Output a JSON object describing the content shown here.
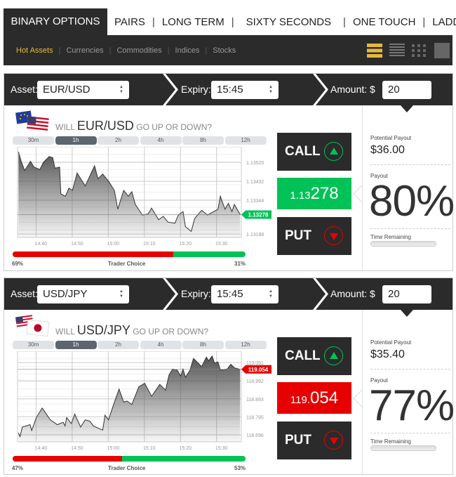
{
  "nav": {
    "brand": "BINARY OPTIONS",
    "tabs": [
      "PAIRS",
      "LONG TERM",
      "SIXTY SECONDS",
      "ONE TOUCH",
      "LADDER"
    ],
    "categories": [
      "Hot Assets",
      "Currencies",
      "Commodities",
      "Indices",
      "Stocks"
    ],
    "active_category": "Hot Assets",
    "view_icons": [
      "large-list-icon",
      "compact-list-icon",
      "grid-icon",
      "single-view-icon"
    ],
    "active_view": "large-list-icon"
  },
  "colors": {
    "accent": "#e6b93a",
    "up": "#00c257",
    "down": "#e60000",
    "dark": "#2b2b2b"
  },
  "panels": [
    {
      "asset_label": "Asset:",
      "asset": "EUR/USD",
      "expiry_label": "Expiry:",
      "expiry": "15:45",
      "amount_label": "Amount: $",
      "amount": "20",
      "question_pre": "WILL",
      "question_asset": "EUR/USD",
      "question_post": "GO UP OR DOWN?",
      "flag": "eu-us-flag-icon",
      "timeframes": [
        "30m",
        "1h",
        "2h",
        "4h",
        "8h",
        "12h"
      ],
      "active_timeframe": "1h",
      "call_label": "CALL",
      "put_label": "PUT",
      "price_prefix": "1.13",
      "price_main": "278",
      "price_direction": "up",
      "trader_choice_label": "Trader Choice",
      "put_pct": "69%",
      "call_pct": "31%",
      "put_share": 69,
      "potential_payout_label": "Potential Payout",
      "potential_payout": "$36.00",
      "payout_label": "Payout",
      "payout": "80%",
      "time_remaining_label": "Time Remaining"
    },
    {
      "asset_label": "Asset:",
      "asset": "USD/JPY",
      "expiry_label": "Expiry:",
      "expiry": "15:45",
      "amount_label": "Amount: $",
      "amount": "20",
      "question_pre": "WILL",
      "question_asset": "USD/JPY",
      "question_post": "GO UP OR DOWN?",
      "flag": "us-jp-flag-icon",
      "timeframes": [
        "30m",
        "1h",
        "2h",
        "4h",
        "8h",
        "12h"
      ],
      "active_timeframe": "1h",
      "call_label": "CALL",
      "put_label": "PUT",
      "price_prefix": "119.",
      "price_main": "054",
      "price_direction": "down",
      "trader_choice_label": "Trader Choice",
      "put_pct": "47%",
      "call_pct": "53%",
      "put_share": 47,
      "potential_payout_label": "Potential Payout",
      "potential_payout": "$35.40",
      "payout_label": "Payout",
      "payout": "77%",
      "time_remaining_label": "Time Remaining"
    }
  ],
  "chart_data": [
    {
      "type": "area",
      "xlabel": "",
      "ylabel": "",
      "x_ticks": [
        "14:40",
        "14:50",
        "15:00",
        "15:10",
        "15:20",
        "15:30"
      ],
      "y_ticks": [
        "1.13520",
        "1.13432",
        "1.13344",
        "1.13188"
      ],
      "xlim": [
        "14:33:30",
        "15:35:30"
      ],
      "ylim": [
        1.13172,
        1.13592
      ],
      "grid": true,
      "current_value": "1.13278",
      "x": [
        "14:33:45",
        "14:34:31",
        "14:35:29",
        "14:37:06",
        "14:38:04",
        "14:39:41",
        "14:40:39",
        "14:42:16",
        "14:43:14",
        "14:43:52",
        "14:45:10",
        "14:45:29",
        "14:46:46",
        "14:47:44",
        "14:48:43",
        "14:50:00",
        "14:52:15",
        "14:54:50",
        "14:55:48",
        "14:57:06",
        "14:58:43",
        "15:00:19",
        "15:01:17",
        "15:02:54",
        "15:04:12",
        "15:05:10",
        "15:06:08",
        "15:08:04",
        "15:09:41",
        "15:10:39",
        "15:12:35",
        "15:13:52",
        "15:15:10",
        "15:17:06",
        "15:18:04",
        "15:19:21",
        "15:20:00",
        "15:21:37",
        "15:22:35",
        "15:24:31",
        "15:26:08",
        "15:29:02",
        "15:29:41",
        "15:30:58",
        "15:31:56",
        "15:32:54",
        "15:33:33",
        "15:35:10"
      ],
      "values": [
        1.13569,
        1.13525,
        1.13482,
        1.13525,
        1.13498,
        1.13487,
        1.1352,
        1.13547,
        1.13542,
        1.13493,
        1.13498,
        1.13374,
        1.13363,
        1.13401,
        1.1339,
        1.13471,
        1.13411,
        1.13504,
        1.13444,
        1.13466,
        1.13433,
        1.1339,
        1.13303,
        1.1339,
        1.13363,
        1.13384,
        1.13325,
        1.13276,
        1.13281,
        1.13308,
        1.13254,
        1.1327,
        1.13243,
        1.13238,
        1.13276,
        1.13292,
        1.13222,
        1.132,
        1.1326,
        1.13298,
        1.13276,
        1.13303,
        1.13363,
        1.13303,
        1.1333,
        1.13292,
        1.13325,
        1.13278
      ]
    },
    {
      "type": "area",
      "xlabel": "",
      "ylabel": "",
      "x_ticks": [
        "14:40",
        "14:50",
        "15:00",
        "15:10",
        "15:20",
        "15:30"
      ],
      "y_ticks": [
        "119.091",
        "118.992",
        "118.893",
        "118.795",
        "118.696"
      ],
      "xlim": [
        "14:33:30",
        "15:35:30"
      ],
      "ylim": [
        118.658,
        119.153
      ],
      "grid": true,
      "current_value": "119.054",
      "x": [
        "14:33:45",
        "14:34:11",
        "14:34:50",
        "14:36:58",
        "14:37:25",
        "14:38:43",
        "14:40:19",
        "14:42:35",
        "14:44:31",
        "14:46:08",
        "14:46:39",
        "14:47:06",
        "14:48:23",
        "14:49:21",
        "14:50:58",
        "14:52:15",
        "14:53:33",
        "14:54:31",
        "14:57:06",
        "14:57:44",
        "14:58:43",
        "15:00:00",
        "15:01:37",
        "15:02:54",
        "15:03:52",
        "15:05:10",
        "15:07:06",
        "15:08:43",
        "15:10:39",
        "15:12:54",
        "15:14:31",
        "15:15:29",
        "15:16:27",
        "15:17:44",
        "15:18:43",
        "15:19:21",
        "15:20:00",
        "15:21:17",
        "15:22:15",
        "15:24:31",
        "15:25:49",
        "15:26:27",
        "15:27:25",
        "15:28:04",
        "15:29:02",
        "15:29:41",
        "15:31:37",
        "15:32:35",
        "15:33:33",
        "15:35:10"
      ],
      "values": [
        118.707,
        118.687,
        118.739,
        118.752,
        118.72,
        118.791,
        118.843,
        118.778,
        118.752,
        118.765,
        118.745,
        118.791,
        118.758,
        118.81,
        118.739,
        118.778,
        118.771,
        118.745,
        118.722,
        118.804,
        118.778,
        118.855,
        118.946,
        118.875,
        118.881,
        118.862,
        118.959,
        118.978,
        118.907,
        118.972,
        118.94,
        119.024,
        119.056,
        119.05,
        119.017,
        119.056,
        119.011,
        119.05,
        119.114,
        119.069,
        119.121,
        119.101,
        119.127,
        119.088,
        119.095,
        119.05,
        119.056,
        119.082,
        119.063,
        119.054
      ]
    }
  ]
}
